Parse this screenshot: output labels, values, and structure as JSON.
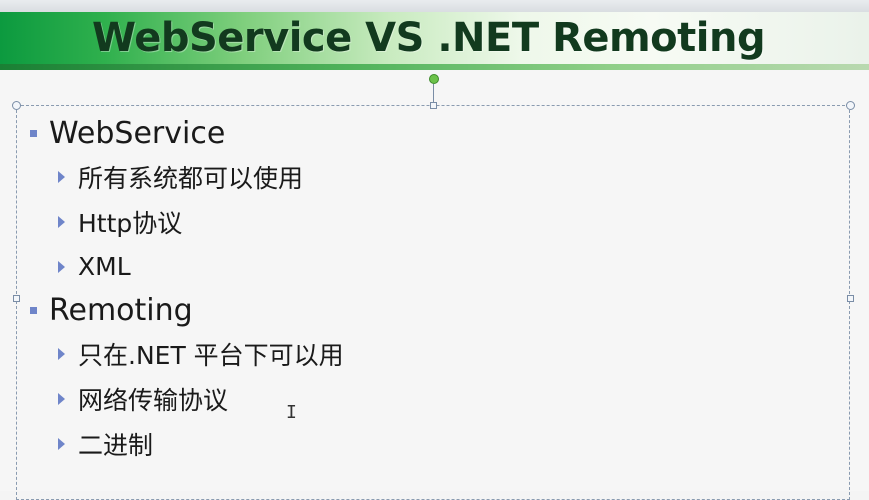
{
  "slide": {
    "title": "WebService VS .NET Remoting",
    "sections": [
      {
        "heading": "WebService",
        "items": [
          "所有系统都可以使用",
          "Http协议",
          "XML"
        ]
      },
      {
        "heading": "Remoting",
        "items": [
          "只在.NET 平台下可以用",
          "网络传输协议",
          "二进制"
        ]
      }
    ]
  },
  "colors": {
    "title_text": "#123a1e",
    "banner_green": "#0c9a3f",
    "bullet": "#6f85c9",
    "selection_border": "#8a9bb0",
    "rotate_handle": "#6cc24a"
  },
  "icons": {
    "text_cursor": "I"
  }
}
